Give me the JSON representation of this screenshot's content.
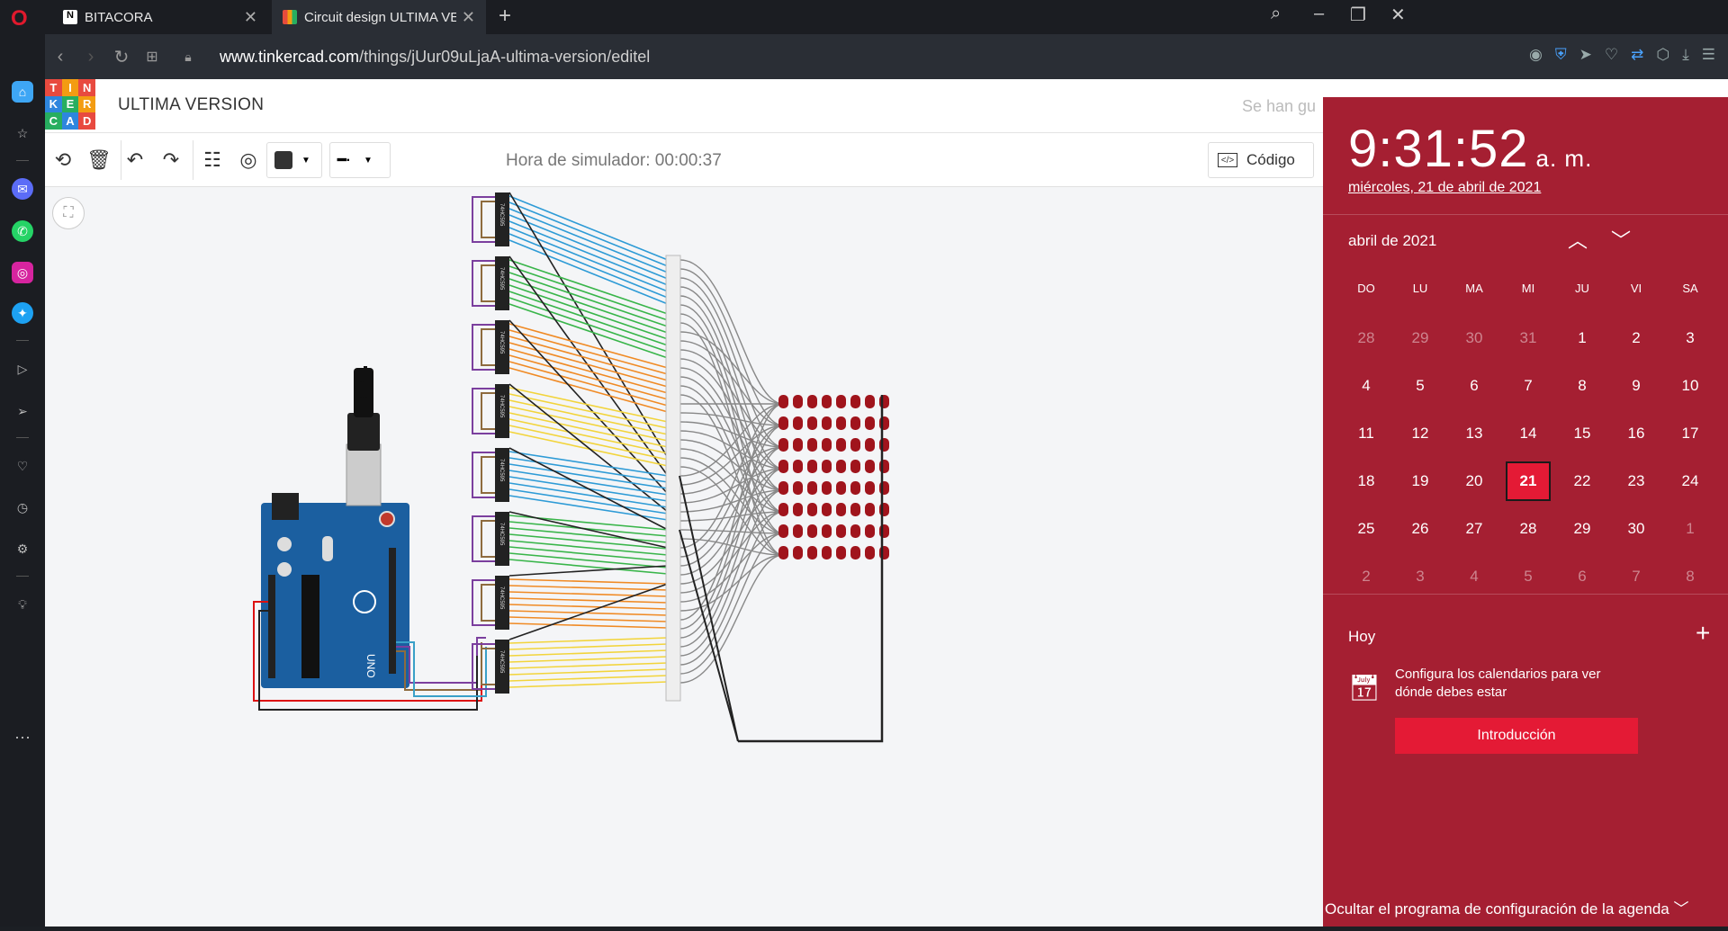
{
  "browser": {
    "tabs": [
      {
        "title": "BITACORA",
        "active": false
      },
      {
        "title": "Circuit design ULTIMA VER",
        "active": true
      }
    ],
    "url_domain": "www.tinkercad.com",
    "url_path": "/things/jUur09uLjaA-ultima-version/editel"
  },
  "tinkercad": {
    "logo_letters": [
      "T",
      "I",
      "N",
      "K",
      "E",
      "R",
      "C",
      "A",
      "D"
    ],
    "project_title": "ULTIMA VERSION",
    "saved_status": "Se han gu",
    "simulator_time": "Hora de simulador: 00:00:37",
    "code_button": "Código",
    "chip_label": "74HC595",
    "arduino_label": "UNO"
  },
  "calendar": {
    "time": "9:31:52",
    "ampm": "a. m.",
    "date_long": "miércoles, 21 de abril de 2021",
    "month_label": "abril de 2021",
    "weekdays": [
      "DO",
      "LU",
      "MA",
      "MI",
      "JU",
      "VI",
      "SA"
    ],
    "weeks": [
      [
        "28",
        "29",
        "30",
        "31",
        "1",
        "2",
        "3"
      ],
      [
        "4",
        "5",
        "6",
        "7",
        "8",
        "9",
        "10"
      ],
      [
        "11",
        "12",
        "13",
        "14",
        "15",
        "16",
        "17"
      ],
      [
        "18",
        "19",
        "20",
        "21",
        "22",
        "23",
        "24"
      ],
      [
        "25",
        "26",
        "27",
        "28",
        "29",
        "30",
        "1"
      ],
      [
        "2",
        "3",
        "4",
        "5",
        "6",
        "7",
        "8"
      ]
    ],
    "today": "21",
    "today_label": "Hoy",
    "event_text": "Configura los calendarios para ver dónde debes estar",
    "intro_button": "Introducción",
    "footer_link": "Ocultar el programa de configuración de la agenda"
  },
  "colors": {
    "accent_red": "#e41a35",
    "calendar_bg": "#a51f32",
    "arduino_blue": "#1b5fa0",
    "led_red": "#a0141c"
  }
}
